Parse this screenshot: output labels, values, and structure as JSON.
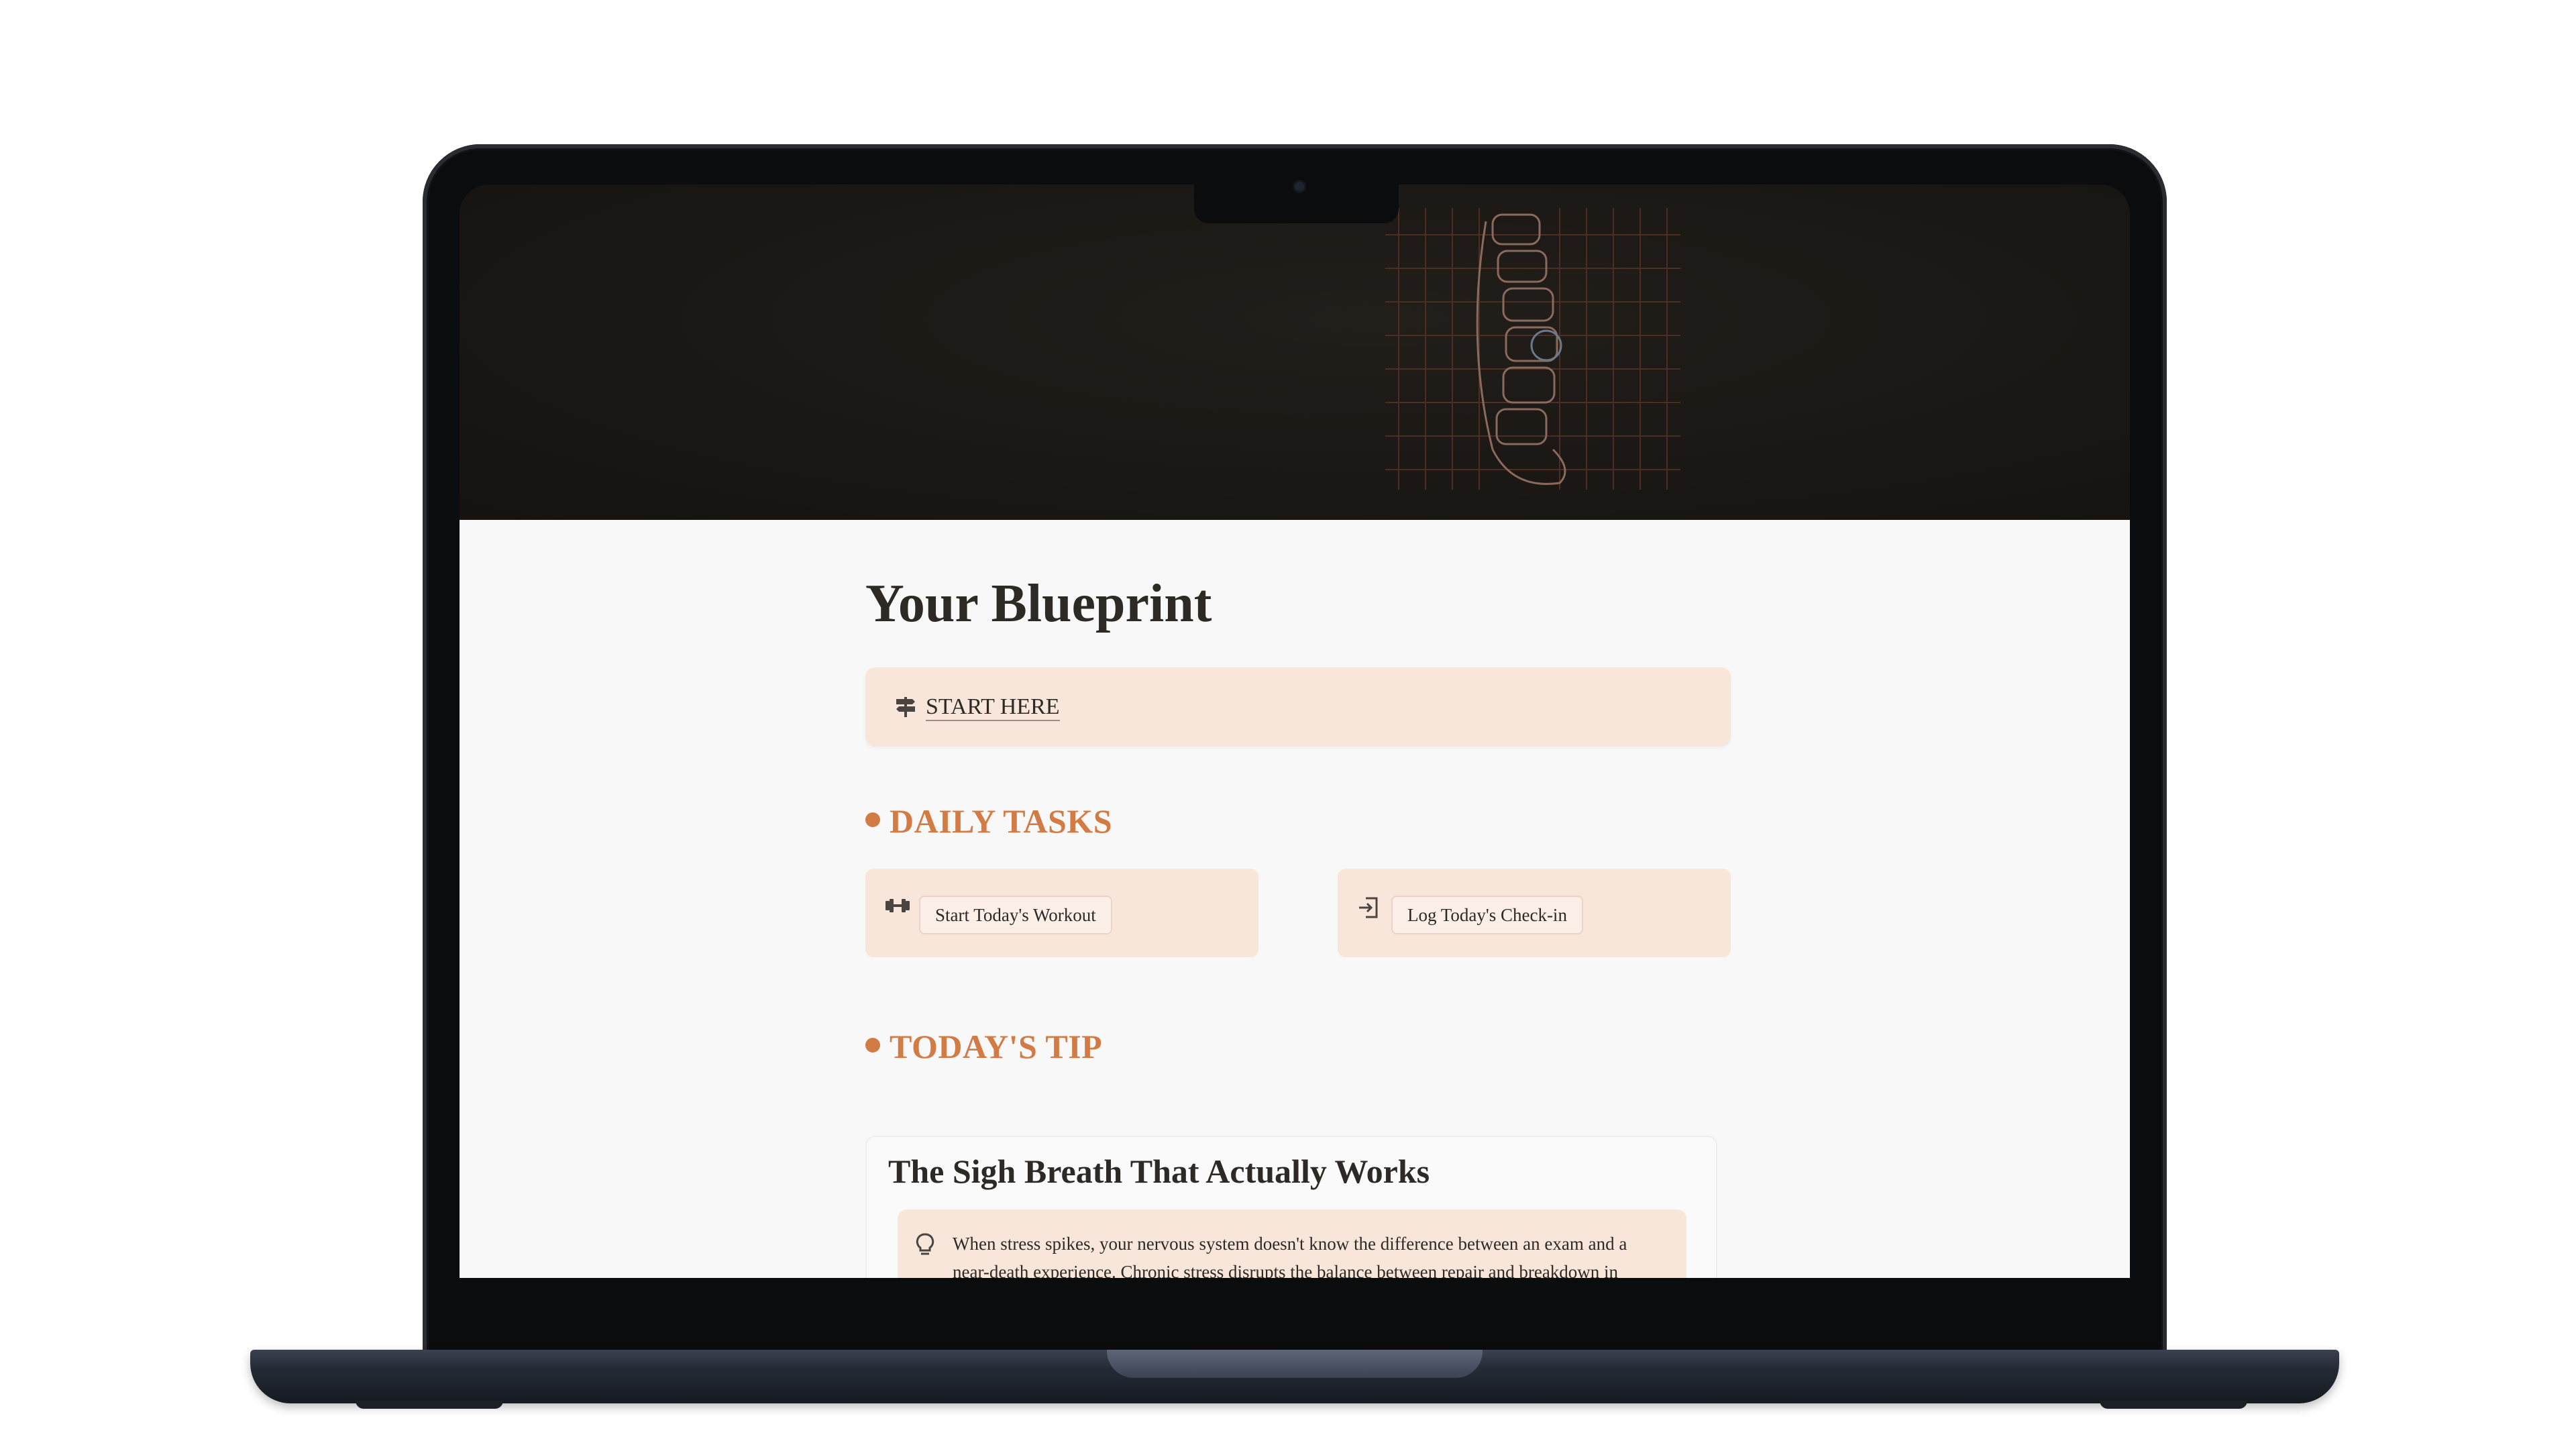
{
  "page": {
    "title": "Your Blueprint",
    "start_here": {
      "label": "START HERE",
      "icon": "signpost-icon"
    },
    "daily_tasks": {
      "heading": "DAILY TASKS",
      "items": [
        {
          "label": "Start Today's Workout",
          "icon": "dumbbell-icon"
        },
        {
          "label": "Log Today's Check-in",
          "icon": "login-icon"
        }
      ]
    },
    "todays_tip": {
      "heading": "TODAY'S TIP",
      "card_title": "The Sigh Breath That Actually Works",
      "icon": "lightbulb-icon",
      "body": "When stress spikes, your nervous system doesn't know the difference between an exam and a near-death experience. Chronic stress disrupts the balance between repair and breakdown in"
    }
  },
  "colors": {
    "accent": "#d37b44",
    "callout_bg": "#f9e6da",
    "page_bg": "#f8f8f8",
    "cover_bg": "#1a1714",
    "text": "#2d2a26"
  }
}
